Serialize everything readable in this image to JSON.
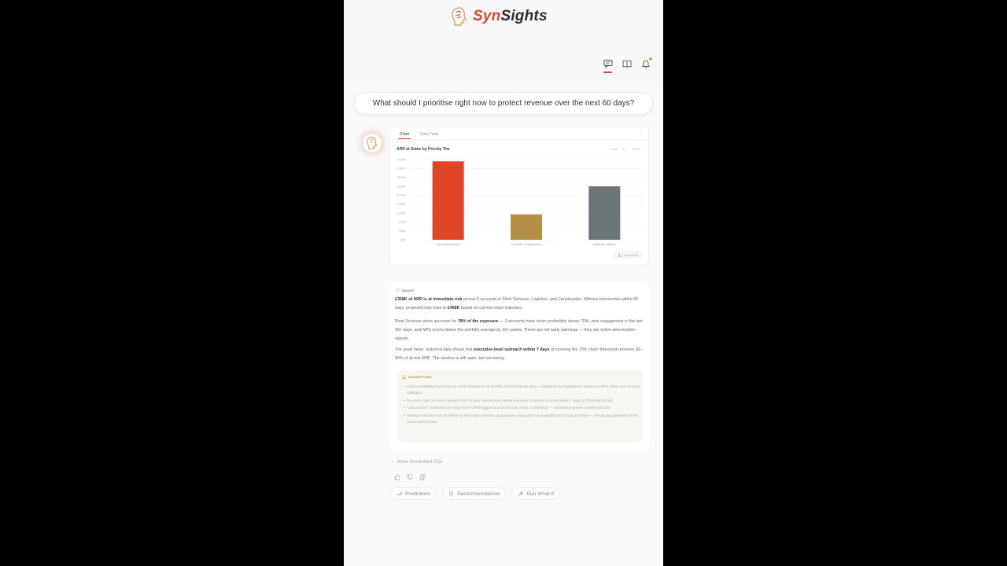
{
  "header": {
    "brand_part1": "Syn",
    "brand_part2": "Sights",
    "icons": [
      "chat-icon",
      "book-icon",
      "bell-icon"
    ]
  },
  "question": "What should I prioritise right now to protect revenue over the next 60 days?",
  "tabs": {
    "chart": "Chart",
    "table": "Data Table"
  },
  "chart_controls": {
    "a": "Pivot",
    "b": "1:1",
    "c": "Reset"
  },
  "download_label": "Download",
  "chart_data": {
    "type": "bar",
    "title": "ARR at Stake by Priority Tier",
    "categories": [
      "Immediate Action",
      "Proactive Engagement",
      "Strategic Initiative"
    ],
    "values": [
      308,
      100,
      210
    ],
    "y_ticks": [
      "£0K",
      "£35K",
      "£70K",
      "£105K",
      "£140K",
      "£175K",
      "£210K",
      "£245K",
      "£280K",
      "£315K"
    ],
    "ylim": [
      0,
      315
    ],
    "colors": [
      "#e04526",
      "#b38f45",
      "#6b7577"
    ],
    "grid": true
  },
  "insight": {
    "label": "INSIGHT",
    "p1_b1": "£308K of ARR is at immediate risk",
    "p1_t1": " across 5 accounts in Fleet Services, Logistics, and Construction. Without intervention within 60 days, projected loss rises to ",
    "p1_b2": "£468K",
    "p1_t2": " based on current churn trajectory.",
    "p2_t1": "Fleet Services alone accounts for ",
    "p2_b1": "78% of the exposure",
    "p2_t2": " — 3 accounts have churn probability above 70%, zero engagement in the last 30+ days, and NPS scores below the portfolio average by 20+ points. These are not early warnings — they are active deterioration signals.",
    "p3_t1": "The good news: historical data shows that ",
    "p3_b1": "executive-level outreach within 7 days",
    "p3_t2": " of crossing the 70% churn threshold recovers 30–40% of at-risk ARR. The window is still open, but narrowing.",
    "assumptions_title": "ASSUMPTIONS",
    "assumptions": [
      "Churn probability scored by ML model trained on 18 months of historical exit data — weighted by engagement frequency, NPS trend, and contract utilisation",
      "Recovery rate (30–40%) derived from 23 prior interventions where executive outreach occurred within 7 days of threshold breach",
      "\"Last contact\" measured as most recent CRM-logged touchpoint (call, email, or meeting) — automated system emails excluded",
      "Strategic initiative ROI modelled on fleet-wide retention programmes deployed in comparable B2B SaaS portfolios — 90-day lag assumed before measurable impact"
    ]
  },
  "show_sql": "Show Generated SQL",
  "actions": {
    "predictions": "Predictions",
    "recommendations": "Recommendations",
    "whatif": "Run What-If"
  }
}
